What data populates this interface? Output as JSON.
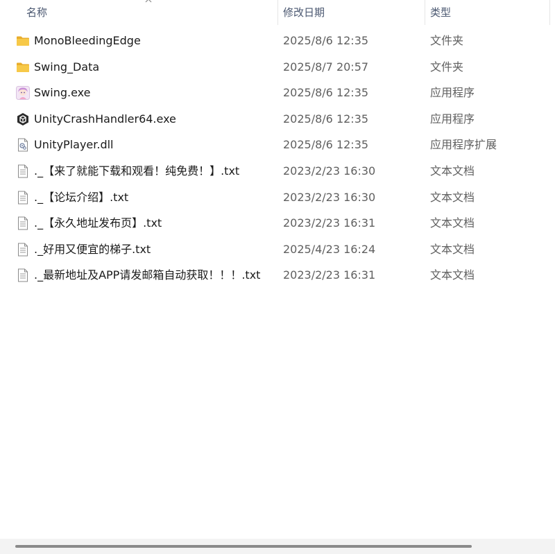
{
  "columns": {
    "name": "名称",
    "date": "修改日期",
    "type": "类型",
    "sort_indicator": "chevron-up-icon"
  },
  "files": [
    {
      "name": "MonoBleedingEdge",
      "date": "2025/8/6 12:35",
      "type": "文件夹",
      "icon": "folder-icon"
    },
    {
      "name": "Swing_Data",
      "date": "2025/8/7 20:57",
      "type": "文件夹",
      "icon": "folder-icon"
    },
    {
      "name": "Swing.exe",
      "date": "2025/8/6 12:35",
      "type": "应用程序",
      "icon": "app-character-icon"
    },
    {
      "name": "UnityCrashHandler64.exe",
      "date": "2025/8/6 12:35",
      "type": "应用程序",
      "icon": "unity-icon"
    },
    {
      "name": "UnityPlayer.dll",
      "date": "2025/8/6 12:35",
      "type": "应用程序扩展",
      "icon": "dll-file-icon"
    },
    {
      "name": "._【来了就能下载和观看！纯免费！】.txt",
      "date": "2023/2/23 16:30",
      "type": "文本文档",
      "icon": "text-file-icon"
    },
    {
      "name": "._【论坛介绍】.txt",
      "date": "2023/2/23 16:30",
      "type": "文本文档",
      "icon": "text-file-icon"
    },
    {
      "name": "._【永久地址发布页】.txt",
      "date": "2023/2/23 16:31",
      "type": "文本文档",
      "icon": "text-file-icon"
    },
    {
      "name": "._好用又便宜的梯子.txt",
      "date": "2025/4/23 16:24",
      "type": "文本文档",
      "icon": "text-file-icon"
    },
    {
      "name": "._最新地址及APP请发邮箱自动获取！！！.txt",
      "date": "2023/2/23 16:31",
      "type": "文本文档",
      "icon": "text-file-icon"
    }
  ],
  "colors": {
    "folder": "#f5c242",
    "header_text": "#4a5770",
    "secondary_text": "#5f5f5f",
    "scroll_thumb": "#8a8a8a"
  }
}
